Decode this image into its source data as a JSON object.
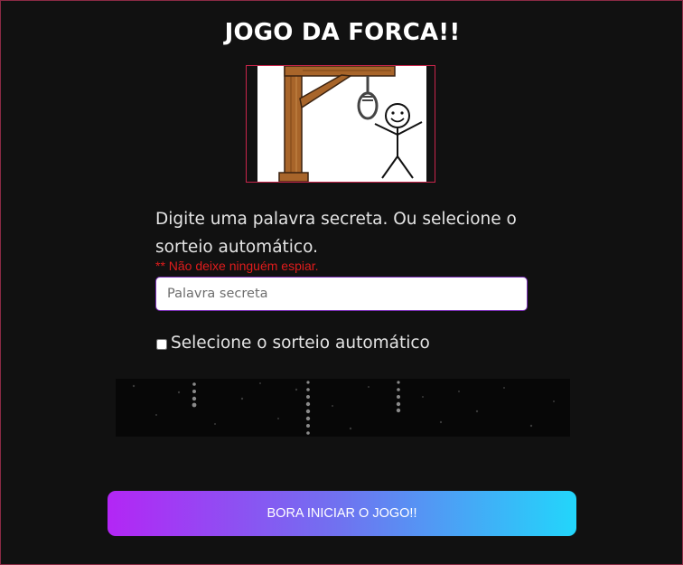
{
  "header": {
    "title": "JOGO DA FORCA!!"
  },
  "hero": {
    "image": "hangman-stickfigure"
  },
  "form": {
    "instructions": "Digite uma palavra secreta. Ou selecione o sorteio automático.",
    "warning": "** Não deixe ninguém espiar.",
    "secret_word_value": "",
    "secret_word_placeholder": "Palavra secreta",
    "auto_draw_label": "Selecione o sorteio automático",
    "auto_draw_checked": false
  },
  "actions": {
    "start_label": "BORA INICIAR O JOGO!!"
  },
  "colors": {
    "background": "#111111",
    "frame_border": "#8a2a45",
    "image_border": "#c8254b",
    "warning": "#e01c1c",
    "button_gradient": [
      "#b326f5",
      "#6f73f0",
      "#22d6fb"
    ]
  }
}
